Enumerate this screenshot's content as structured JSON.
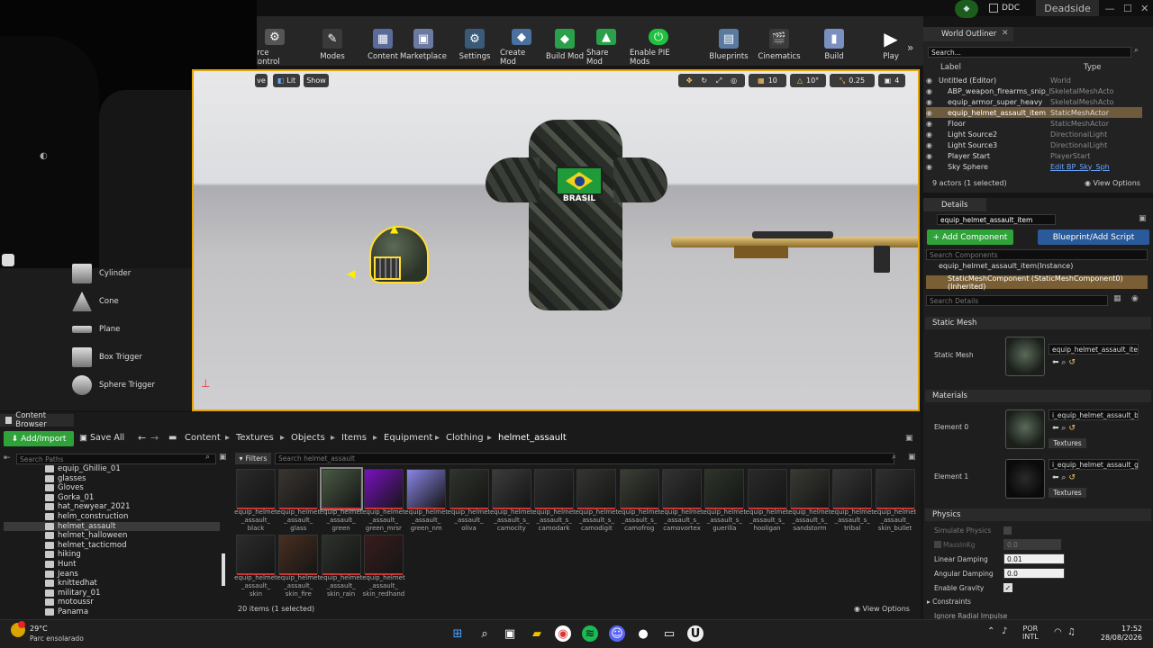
{
  "window": {
    "app_label": "DDC",
    "tab": "Deadside"
  },
  "toolbar": {
    "buttons": [
      {
        "label": "urce Control",
        "icon": "source-control-icon"
      },
      {
        "label": "Modes",
        "icon": "modes-icon"
      },
      {
        "label": "Content",
        "icon": "content-icon"
      },
      {
        "label": "Marketplace",
        "icon": "marketplace-icon"
      },
      {
        "label": "Settings",
        "icon": "settings-icon"
      },
      {
        "label": "Create Mod",
        "icon": "create-mod-icon"
      },
      {
        "label": "Build Mod",
        "icon": "build-mod-icon"
      },
      {
        "label": "Share Mod",
        "icon": "share-mod-icon"
      },
      {
        "label": "Enable PIE Mods",
        "icon": "enable-pie-icon"
      },
      {
        "label": "Blueprints",
        "icon": "blueprints-icon"
      },
      {
        "label": "Cinematics",
        "icon": "cinematics-icon"
      },
      {
        "label": "Build",
        "icon": "build-icon"
      },
      {
        "label": "Play",
        "icon": "play-icon"
      }
    ]
  },
  "modes_panel": {
    "items": [
      "Cylinder",
      "Cone",
      "Plane",
      "Box Trigger",
      "Sphere Trigger"
    ]
  },
  "viewport": {
    "left_btn": "ve",
    "lit": "Lit",
    "show": "Show",
    "grid_snap": "10",
    "rot_snap": "10°",
    "scale_snap": "0.25",
    "cam_speed": "4",
    "armor_text": "BRASIL"
  },
  "outliner": {
    "title": "World Outliner",
    "search_placeholder": "Search...",
    "col_label": "Label",
    "col_type": "Type",
    "rows": [
      {
        "label": "Untitled (Editor)",
        "type": "World"
      },
      {
        "label": "ABP_weapon_firearms_snip_barret",
        "type": "SkeletalMeshActo"
      },
      {
        "label": "equip_armor_super_heavy",
        "type": "SkeletalMeshActo"
      },
      {
        "label": "equip_helmet_assault_item",
        "type": "StaticMeshActor"
      },
      {
        "label": "Floor",
        "type": "StaticMeshActor"
      },
      {
        "label": "Light Source2",
        "type": "DirectionalLight"
      },
      {
        "label": "Light Source3",
        "type": "DirectionalLight"
      },
      {
        "label": "Player Start",
        "type": "PlayerStart"
      },
      {
        "label": "Sky Sphere",
        "type": "Edit BP_Sky_Sph"
      }
    ],
    "footer": "9 actors (1 selected)",
    "view_options": "View Options"
  },
  "details": {
    "title": "Details",
    "name_value": "equip_helmet_assault_item",
    "add_component": "+ Add Component",
    "blueprint_script": "Blueprint/Add Script",
    "search_components": "Search Components",
    "instance_row": "equip_helmet_assault_item(Instance)",
    "component_row": "StaticMeshComponent (StaticMeshComponent0) (Inherited)",
    "search_details": "Search Details",
    "static_mesh_section": "Static Mesh",
    "static_mesh_label": "Static Mesh",
    "static_mesh_value": "equip_helmet_assault_item",
    "materials_section": "Materials",
    "element0_label": "Element 0",
    "element0_value": "i_equip_helmet_assault_b_g",
    "element1_label": "Element 1",
    "element1_value": "i_equip_helmet_assault_gla",
    "textures_btn": "Textures",
    "physics_section": "Physics",
    "simulate_physics": "Simulate Physics",
    "mass_kg": "MassInKg",
    "mass_value": "0.0",
    "linear_damping": "Linear Damping",
    "linear_value": "0.01",
    "angular_damping": "Angular Damping",
    "angular_value": "0.0",
    "enable_gravity": "Enable Gravity",
    "constraints": "Constraints",
    "ignore_radial": "Ignore Radial Impulse"
  },
  "content_browser": {
    "title": "Content Browser",
    "add_import": "Add/Import",
    "save_all": "Save All",
    "breadcrumb": [
      "Content",
      "Textures",
      "Objects",
      "Items",
      "Equipment",
      "Clothing",
      "helmet_assault"
    ],
    "search_paths": "Search Paths",
    "filters": "Filters",
    "search_assets": "Search helmet_assault",
    "tree": [
      "equip_Ghillie_01",
      "glasses",
      "Gloves",
      "Gorka_01",
      "hat_newyear_2021",
      "helm_construction",
      "helmet_assault",
      "helmet_halloween",
      "helmet_tacticmod",
      "hiking",
      "Hunt",
      "Jeans",
      "knittedhat",
      "military_01",
      "motoussr",
      "Panama"
    ],
    "assets": [
      {
        "label": "equip_helmet _assault_ black",
        "color": "#2a2a2a"
      },
      {
        "label": "equip_helmet _assault_ glass",
        "color": "#3a3530"
      },
      {
        "label": "equip_helmet _assault_ green",
        "color": "#4a5a44"
      },
      {
        "label": "equip_helmet _assault_ green_mrsr",
        "color": "#7a10c0"
      },
      {
        "label": "equip_helmet _assault_ green_nm",
        "color": "#8a86e8"
      },
      {
        "label": "equip_helmet _assault_ oliva",
        "color": "#2f342c"
      },
      {
        "label": "equip_helmet _assault_s_ camocity",
        "color": "#3c3c3c"
      },
      {
        "label": "equip_helmet _assault_s_ camodark",
        "color": "#2e2e2e"
      },
      {
        "label": "equip_helmet _assault_s_ camodigit",
        "color": "#343632"
      },
      {
        "label": "equip_helmet _assault_s_ camofrog",
        "color": "#3a3f34"
      },
      {
        "label": "equip_helmet _assault_s_ camovortex",
        "color": "#333"
      },
      {
        "label": "equip_helmet _assault_s_ guerilla",
        "color": "#2d3529"
      },
      {
        "label": "equip_helmet _assault_s_ hooligan",
        "color": "#2a2a2a"
      },
      {
        "label": "equip_helmet _assault_s_ sandstorm",
        "color": "#3a3a33"
      },
      {
        "label": "equip_helmet _assault_s_ tribal",
        "color": "#363636"
      },
      {
        "label": "equip_helmet _assault_ skin_bullet",
        "color": "#2f2f2f"
      },
      {
        "label": "equip_helmet _assault_ skin",
        "color": "#2c2c2c"
      },
      {
        "label": "equip_helmet _assault_ skin_fire",
        "color": "#4a2f20"
      },
      {
        "label": "equip_helmet _assault_ skin_rain",
        "color": "#2e322c"
      },
      {
        "label": "equip_helmet _assault_ skin_redhand",
        "color": "#3a1c1c"
      }
    ],
    "status": "20 items (1 selected)",
    "view_options": "View Options"
  },
  "taskbar": {
    "weather_temp": "29°C",
    "weather_desc": "Parc ensolarado",
    "lang1": "POR",
    "lang2": "INTL",
    "time": "17:52",
    "date": "28/08/2026"
  }
}
